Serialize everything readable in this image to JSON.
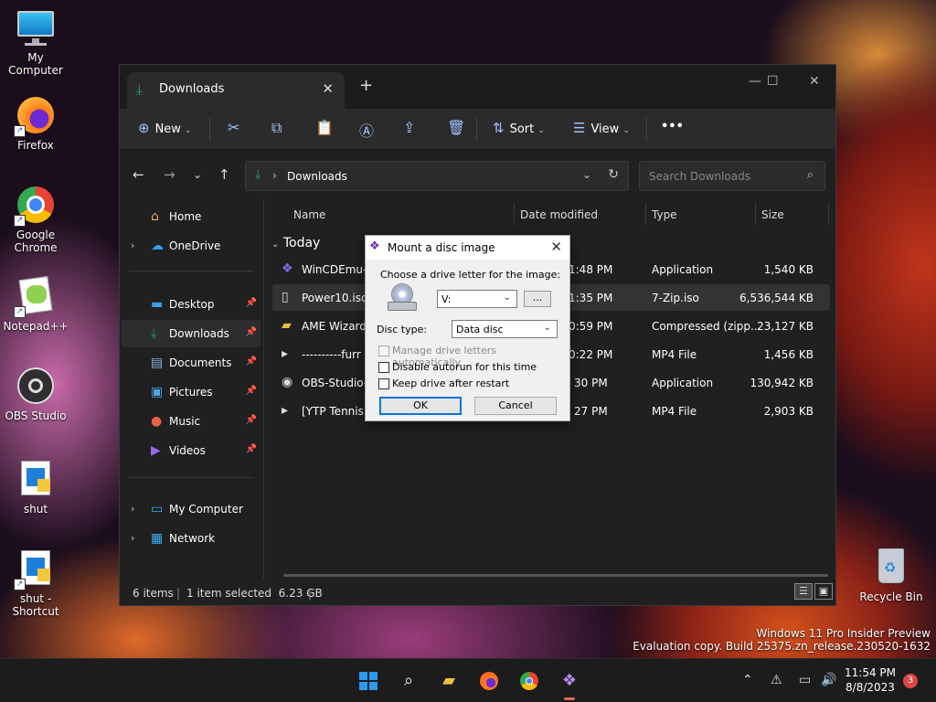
{
  "desktop": {
    "icons": [
      {
        "label": "My Computer"
      },
      {
        "label": "Firefox"
      },
      {
        "label": "Google Chrome"
      },
      {
        "label": "Notepad++"
      },
      {
        "label": "OBS Studio"
      },
      {
        "label": "shut"
      },
      {
        "label": "shut - Shortcut"
      }
    ],
    "recycle_bin": "Recycle Bin",
    "watermark_line1": "Windows 11 Pro Insider Preview",
    "watermark_line2": "Evaluation copy. Build 25375.zn_release.230520-1632"
  },
  "explorer": {
    "tab_title": "Downloads",
    "toolbar": {
      "new_label": "New",
      "sort_label": "Sort",
      "view_label": "View",
      "more_label": "•••"
    },
    "address": {
      "path": "Downloads",
      "search_placeholder": "Search Downloads"
    },
    "sidebar": {
      "top": [
        {
          "label": "Home"
        },
        {
          "label": "OneDrive"
        }
      ],
      "pinned": [
        {
          "label": "Desktop"
        },
        {
          "label": "Downloads"
        },
        {
          "label": "Documents"
        },
        {
          "label": "Pictures"
        },
        {
          "label": "Music"
        },
        {
          "label": "Videos"
        }
      ],
      "bottom": [
        {
          "label": "My Computer"
        },
        {
          "label": "Network"
        }
      ]
    },
    "columns": {
      "name": "Name",
      "date": "Date modified",
      "type": "Type",
      "size": "Size"
    },
    "group": "Today",
    "files": [
      {
        "name": "WinCDEmu-4",
        "date": "1:48 PM",
        "type": "Application",
        "size": "1,540 KB"
      },
      {
        "name": "Power10.iso",
        "date": "1:35 PM",
        "type": "7-Zip.iso",
        "size": "6,536,544 KB"
      },
      {
        "name": "AME Wizard B",
        "date": "0:59 PM",
        "type": "Compressed (zipp...",
        "size": "23,127 KB"
      },
      {
        "name": "----------furr",
        "date": "0:22 PM",
        "type": "MP4 File",
        "size": "1,456 KB"
      },
      {
        "name": "OBS-Studio-2",
        "date": "30 PM",
        "type": "Application",
        "size": "130,942 KB"
      },
      {
        "name": "[YTP Tennis] -",
        "date": "27 PM",
        "type": "MP4 File",
        "size": "2,903 KB"
      }
    ],
    "status": {
      "items": "6 items",
      "selected": "1 item selected  6.23 GB"
    }
  },
  "dialog": {
    "title": "Mount a disc image",
    "choose_label": "Choose a drive letter for the image:",
    "drive_value": "V:",
    "browse_label": "...",
    "disc_type_label": "Disc type:",
    "disc_type_value": "Data disc",
    "opt_manage": "Manage drive letters automatically",
    "opt_autorun": "Disable autorun for this time",
    "opt_keep": "Keep drive after restart",
    "ok_label": "OK",
    "cancel_label": "Cancel"
  },
  "taskbar": {
    "time": "11:54 PM",
    "date": "8/8/2023",
    "notification_count": "3"
  }
}
